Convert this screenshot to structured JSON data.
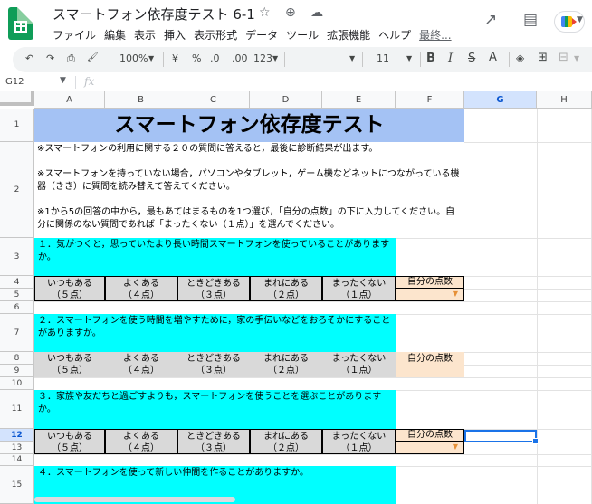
{
  "app": {
    "title": "スマートフォン依存度テスト 6-1",
    "title_icons": "☆ ⊕ ☁",
    "menu": [
      "ファイル",
      "編集",
      "表示",
      "挿入",
      "表示形式",
      "データ",
      "ツール",
      "拡張機能",
      "ヘルプ"
    ],
    "last_edit": "最終...",
    "brand_color": "#0f9d58"
  },
  "toolbar": {
    "undo": "↶",
    "redo": "↷",
    "print": "⎙",
    "paint": "🖌",
    "zoom": "100%",
    "currency": "¥",
    "percent": "%",
    "dec_minus": ".0",
    "dec_plus": ".00",
    "more_formats": "123",
    "font_size": "11",
    "bold": "B",
    "italic": "I",
    "strike": "S",
    "text_color": "A",
    "fill": "◈",
    "borders": "⊞",
    "merge": "⊟"
  },
  "formula_bar": {
    "cell_ref": "G12",
    "fx": "fx"
  },
  "columns": [
    "A",
    "B",
    "C",
    "D",
    "E",
    "F",
    "G",
    "H"
  ],
  "rows": [
    "1",
    "2",
    "3",
    "4",
    "5",
    "6",
    "7",
    "8",
    "9",
    "10",
    "11",
    "12",
    "13",
    "14",
    "15"
  ],
  "sheet": {
    "title": "スマートフォン依存度テスト",
    "instructions": [
      "※スマートフォンの利用に関する２０の質問に答えると，最後に診断結果が出ます。",
      "※スマートフォンを持っていない場合，パソコンやタブレット，ゲーム機などネットにつながっている機器（きき）に質問を読み替えて答えてください。",
      "※1から5の回答の中から，最もあてはまるものを1つ選び，「自分の点数」の下に入力してください。自分に関係のない質問であれば「まったくない（１点）」を選んでください。"
    ],
    "options": [
      {
        "label": "いつもある",
        "points": "（５点）"
      },
      {
        "label": "よくある",
        "points": "（４点）"
      },
      {
        "label": "ときどきある",
        "points": "（３点）"
      },
      {
        "label": "まれにある",
        "points": "（２点）"
      },
      {
        "label": "まったくない",
        "points": "（１点）"
      }
    ],
    "score_label": "自分の点数",
    "dropdown_arrow": "▼",
    "questions": [
      "１．気がつくと，思っていたより長い時間スマートフォンを使っていることがありますか。",
      "２．スマートフォンを使う時間を増やすために，家の手伝いなどをおろそかにすることがありますか。",
      "３．家族や友だちと過ごすよりも，スマートフォンを使うことを選ぶことがありますか。",
      "４．スマートフォンを使って新しい仲間を作ることがありますか。"
    ]
  },
  "colors": {
    "title_fill": "#a4c2f4",
    "question_fill": "#00ffff",
    "option_fill": "#d9d9d9",
    "score_fill": "#fce5cd",
    "selection": "#1a73e8"
  }
}
